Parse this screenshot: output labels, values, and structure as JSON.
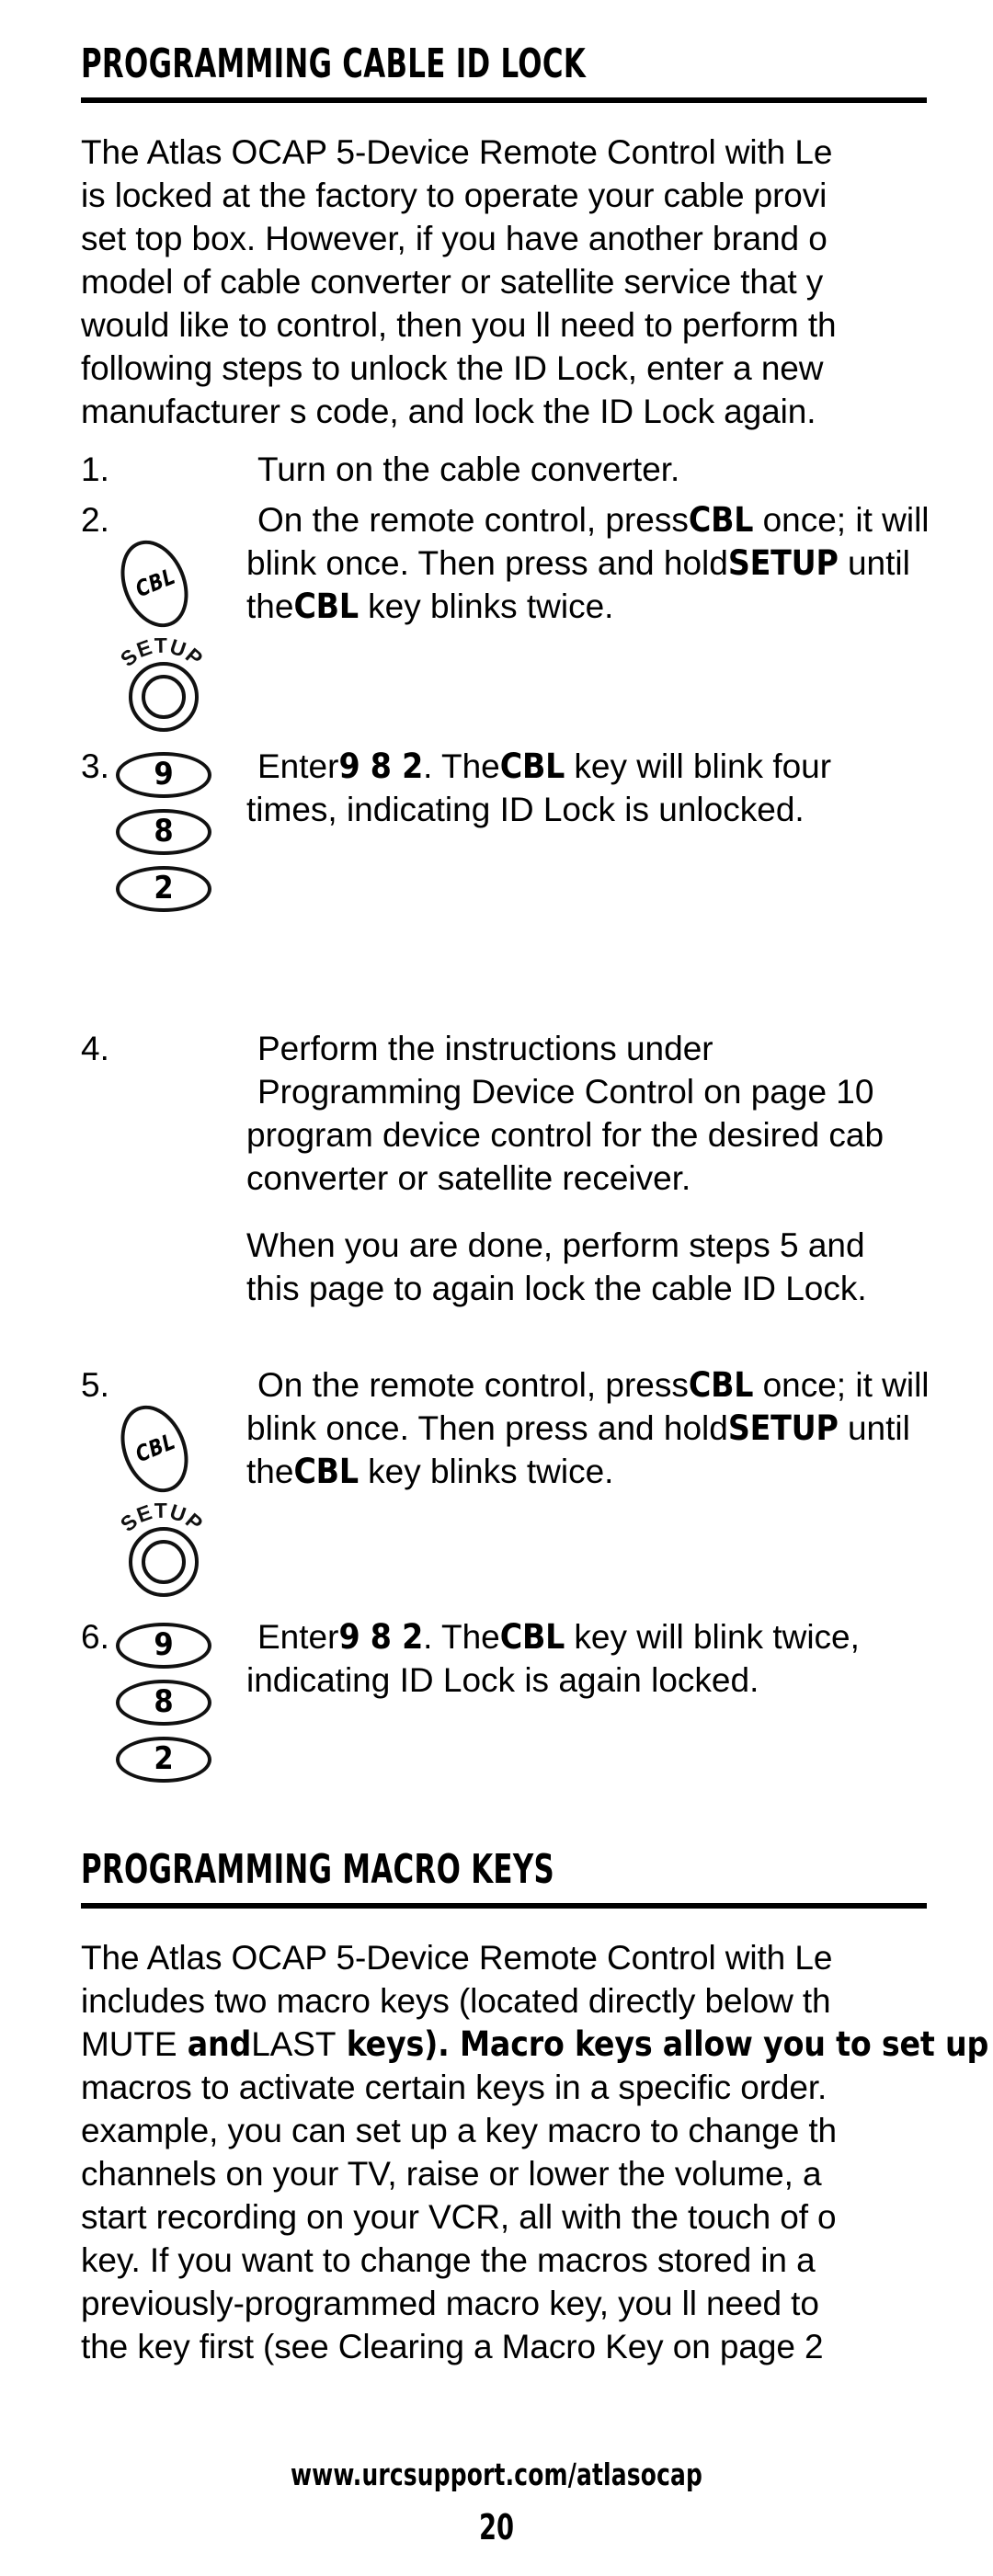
{
  "page": {
    "number": "20",
    "footer_url": "www.urcsupport.com/atlasocap"
  },
  "sections": [
    {
      "id": "cable-id-lock",
      "heading": "PROGRAMMING CABLE ID LOCK",
      "intro": [
        "The Atlas OCAP 5-Device Remote Control with Le",
        "is locked at the factory to operate your cable provi",
        "set top box. However, if you have another brand o",
        "model of cable converter or satellite service that y",
        "would like to control, then you ll need to perform th",
        "following steps to unlock the ID Lock, enter a new",
        "manufacturer s code, and lock the ID Lock again."
      ]
    },
    {
      "id": "macro-keys",
      "heading": "PROGRAMMING MACRO KEYS",
      "intro": [
        "The Atlas OCAP 5-Device Remote Control with Le",
        "includes two macro keys (located directly below th",
        "MUTE| and|LAST| keys). Macro keys allow you to set up",
        "macros to activate certain keys in a specific order.",
        "example, you can set up a key macro to change th",
        "channels on your TV, raise or lower the volume, a",
        "start recording on your VCR, all with the touch of o",
        "key. If you want to change the macros stored in a",
        "previously-programmed macro key, you ll need to",
        "the key first (see  Clearing a Macro Key  on page 2"
      ]
    }
  ],
  "steps": [
    {
      "number": "1.",
      "icons": [],
      "lines": [
        {
          "text": "Turn on the cable converter.",
          "indent": true
        }
      ]
    },
    {
      "number": "2.",
      "icons": [
        {
          "type": "cbl-key",
          "label": "CBL"
        },
        {
          "type": "setup-key",
          "label": "SETUP"
        }
      ],
      "lines": [
        {
          "text": "On the remote control, press|CBL| once; it will",
          "indent": true
        },
        {
          "text": "blink once. Then press and hold|SETUP| until",
          "indent": false
        },
        {
          "text": "the|CBL| key blinks twice.",
          "indent": false
        }
      ]
    },
    {
      "number": "3.",
      "icons": [
        {
          "type": "number-key",
          "label": "9"
        },
        {
          "type": "number-key",
          "label": "8"
        },
        {
          "type": "number-key",
          "label": "2"
        }
      ],
      "lines": [
        {
          "text": "Enter|9  8  2|. The|CBL| key will blink four",
          "indent": true
        },
        {
          "text": "times, indicating ID Lock is unlocked.",
          "indent": false
        }
      ]
    },
    {
      "number": "4.",
      "icons": [],
      "lines": [
        {
          "text": "Perform the instructions under",
          "indent": true
        },
        {
          "text": " Programming Device Control  on page 10",
          "indent": true
        },
        {
          "text": "program device control for the desired cab",
          "indent": false
        },
        {
          "text": "converter or satellite receiver.",
          "indent": false
        },
        {
          "text": "",
          "indent": false,
          "gap": true
        },
        {
          "text": "When you are done, perform steps 5 and",
          "indent": false
        },
        {
          "text": "this page to again lock the cable ID Lock.",
          "indent": false
        }
      ]
    },
    {
      "number": "5.",
      "icons": [
        {
          "type": "cbl-key",
          "label": "CBL"
        },
        {
          "type": "setup-key",
          "label": "SETUP"
        }
      ],
      "lines": [
        {
          "text": "On the remote control, press|CBL| once; it will",
          "indent": true
        },
        {
          "text": "blink once. Then press and hold|SETUP| until",
          "indent": false
        },
        {
          "text": "the|CBL| key blinks twice.",
          "indent": false
        }
      ]
    },
    {
      "number": "6.",
      "icons": [
        {
          "type": "number-key",
          "label": "9"
        },
        {
          "type": "number-key",
          "label": "8"
        },
        {
          "type": "number-key",
          "label": "2"
        }
      ],
      "lines": [
        {
          "text": "Enter|9  8  2|. The|CBL| key will blink twice,",
          "indent": true
        },
        {
          "text": "indicating ID Lock is again locked.",
          "indent": false
        }
      ]
    }
  ]
}
